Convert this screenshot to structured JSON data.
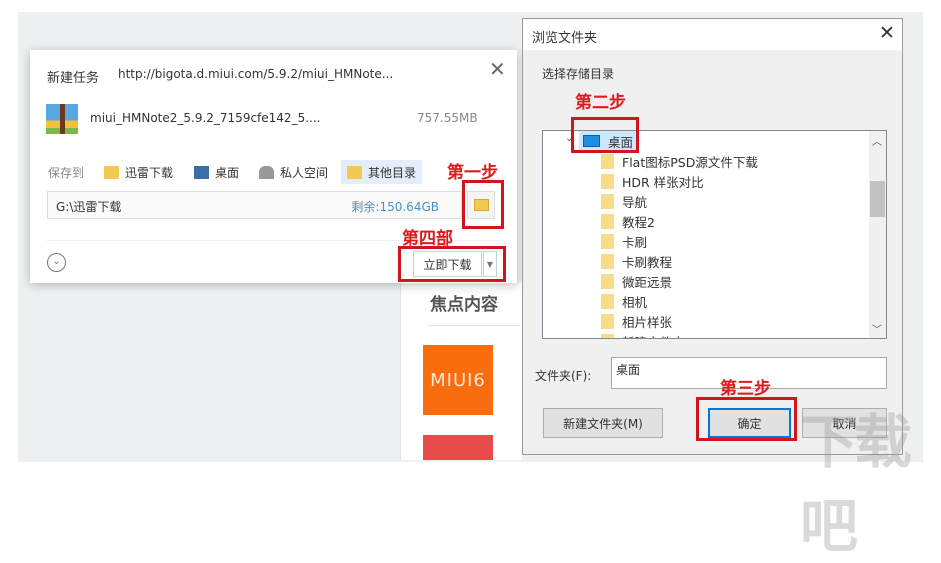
{
  "background": {
    "focus_heading": "焦点内容",
    "miui_tile": "MIUI6",
    "watermark": "下载吧"
  },
  "download_dialog": {
    "title": "新建任务",
    "url": "http://bigota.d.miui.com/5.9.2/miui_HMNote...",
    "file_name": "miui_HMNote2_5.9.2_7159cfe142_5....",
    "file_size": "757.55MB",
    "save_to_label": "保存到",
    "locations": [
      {
        "label": "迅雷下载",
        "icon": "thunder-folder-icon"
      },
      {
        "label": "桌面",
        "icon": "desktop-icon"
      },
      {
        "label": "私人空间",
        "icon": "private-space-icon"
      },
      {
        "label": "其他目录",
        "icon": "folder-icon",
        "active": true
      }
    ],
    "path": "G:\\迅雷下载",
    "free_space": "剩余:150.64GB",
    "download_now": "立即下载"
  },
  "browse_dialog": {
    "title": "浏览文件夹",
    "prompt": "选择存储目录",
    "root": "桌面",
    "folders": [
      "Flat图标PSD源文件下载",
      "HDR 样张对比",
      "导航",
      "教程2",
      "卡刷",
      "卡刷教程",
      "微距远景",
      "相机",
      "相片样张",
      "新建文件夹"
    ],
    "folder_label": "文件夹(F):",
    "folder_value": "桌面",
    "new_folder": "新建文件夹(M)",
    "ok": "确定",
    "cancel": "取消"
  },
  "annotations": {
    "step1": "第一步",
    "step2": "第二步",
    "step3": "第三步",
    "step4": "第四部"
  },
  "colors": {
    "annotation": "#d0161c",
    "accent": "#0078d7",
    "miui": "#f96d0e"
  }
}
